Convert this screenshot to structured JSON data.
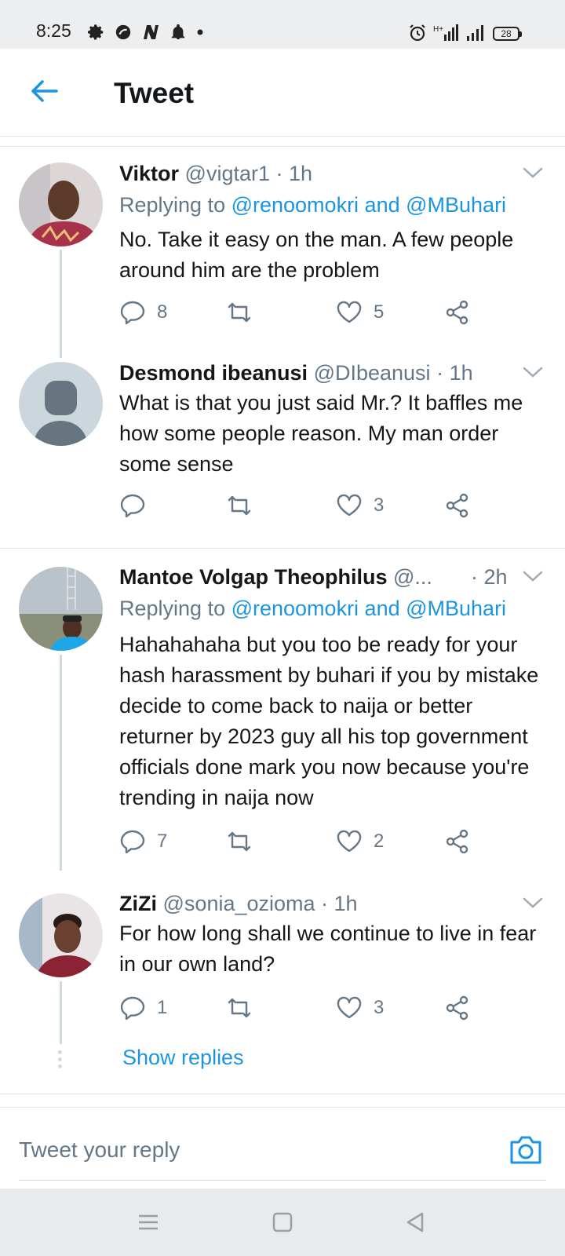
{
  "status_bar": {
    "time": "8:25",
    "battery": "28",
    "network": "H+"
  },
  "header": {
    "title": "Tweet"
  },
  "tweets": [
    {
      "name": "Viktor",
      "handle": "@vigtar1",
      "time": "· 1h",
      "replying_prefix": "Replying to ",
      "replying_mentions": "@renoomokri and @MBuhari",
      "text": "No. Take it easy on the man. A few people around him are the problem",
      "replies": "8",
      "retweets": "",
      "likes": "5"
    },
    {
      "name": "Desmond ibeanusi",
      "handle": "@DIbeanusi",
      "time": "· 1h",
      "text": "What is that you just said Mr.? It baffles me how some people reason. My man order some sense",
      "replies": "",
      "retweets": "",
      "likes": "3"
    },
    {
      "name": "Mantoe Volgap Theophilus",
      "handle": "@...",
      "time": "· 2h",
      "replying_prefix": "Replying to ",
      "replying_mentions": "@renoomokri and @MBuhari",
      "text": "Hahahahaha but you too be ready for your hash  harassment by buhari if you by mistake decide to come back to naija or better returner by 2023 guy all his top government officials done mark you now because you're trending in naija now",
      "replies": "7",
      "retweets": "",
      "likes": "2"
    },
    {
      "name": "ZiZi",
      "handle": "@sonia_ozioma",
      "time": "· 1h",
      "text": "For how long shall we continue to live in fear in our own land?",
      "replies": "1",
      "retweets": "",
      "likes": "3"
    }
  ],
  "show_replies": "Show replies",
  "composer": {
    "placeholder": "Tweet your reply"
  },
  "colors": {
    "accent": "#1b95e0",
    "muted": "#657786",
    "text": "#14171a"
  }
}
